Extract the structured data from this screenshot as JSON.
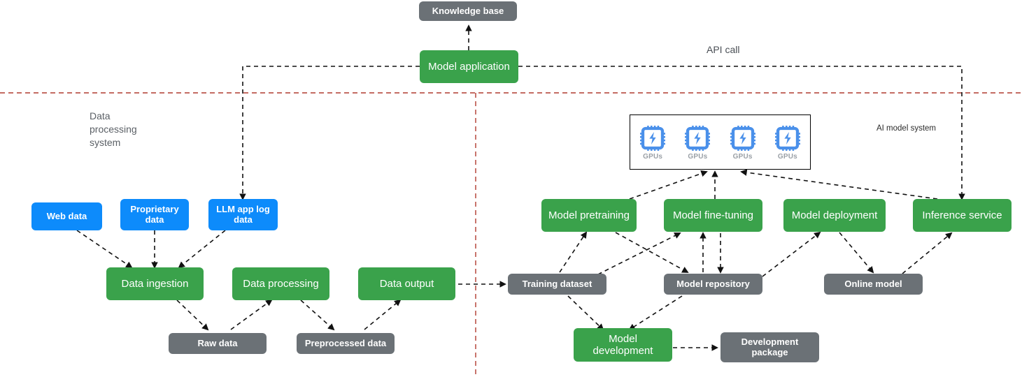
{
  "diagram": {
    "title_zones": {
      "data_processing_system": "Data\nprocessing\nsystem",
      "ai_model_system": "AI model system",
      "api_call": "API call"
    },
    "colors": {
      "green": "#3aa24b",
      "blue": "#0d8bfb",
      "gray": "#6b7176",
      "divider": "#b03a2e",
      "edge": "#111111",
      "gpu_icon": "#4a90ea",
      "gpu_label": "#9aa0a6"
    },
    "nodes": {
      "knowledge_base": "Knowledge base",
      "model_application": "Model application",
      "web_data": "Web data",
      "proprietary_data": "Proprietary\ndata",
      "llm_app_log_data": "LLM app log\ndata",
      "data_ingestion": "Data ingestion",
      "data_processing": "Data processing",
      "data_output": "Data output",
      "raw_data": "Raw data",
      "preprocessed_data": "Preprocessed data",
      "training_dataset": "Training dataset",
      "model_pretraining": "Model pretraining",
      "model_fine_tuning": "Model fine-tuning",
      "model_deployment": "Model deployment",
      "inference_service": "Inference service",
      "model_repository": "Model repository",
      "online_model": "Online model",
      "model_development": "Model\ndevelopment",
      "development_package": "Development\npackage"
    },
    "gpu_panel": {
      "items": [
        {
          "icon": "gpu-chip-icon",
          "label": "GPUs"
        },
        {
          "icon": "gpu-chip-icon",
          "label": "GPUs"
        },
        {
          "icon": "gpu-chip-icon",
          "label": "GPUs"
        },
        {
          "icon": "gpu-chip-icon",
          "label": "GPUs"
        }
      ]
    }
  }
}
